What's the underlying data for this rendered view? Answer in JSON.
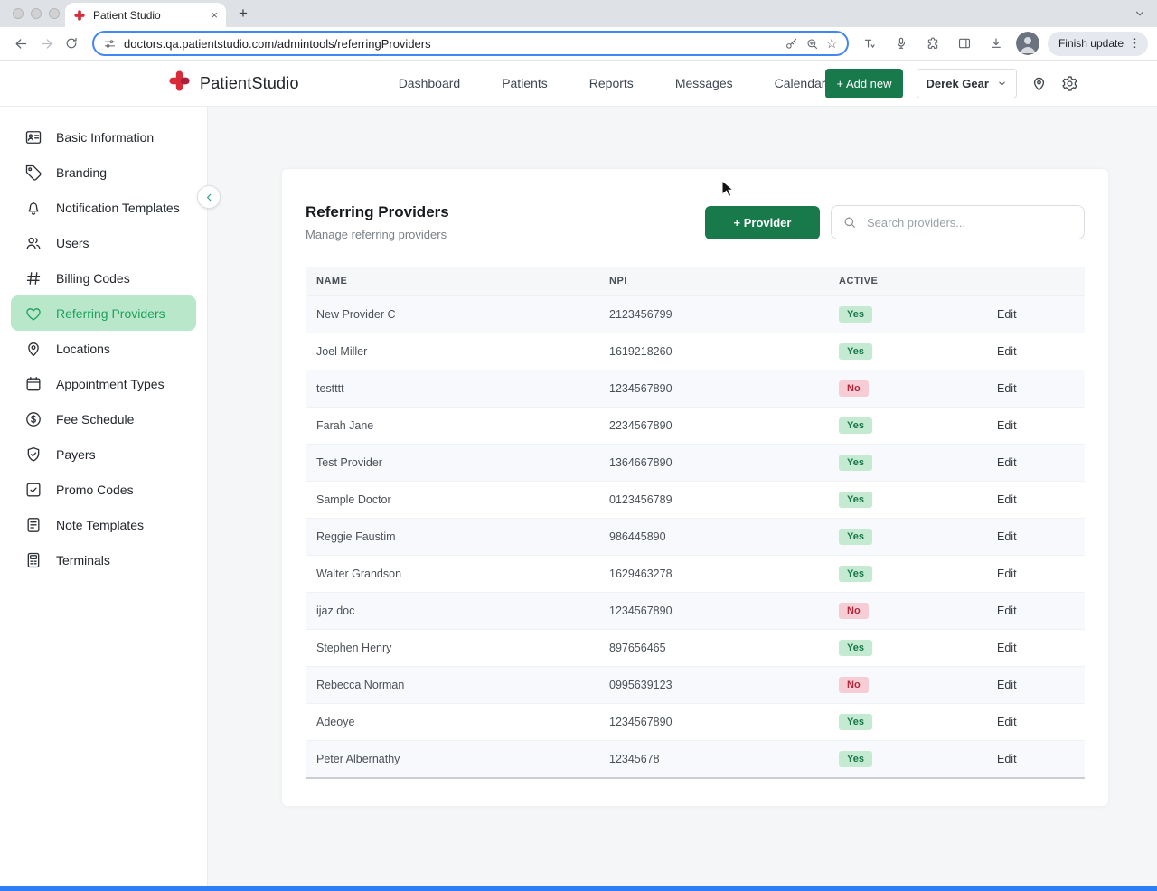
{
  "browser": {
    "tab_title": "Patient Studio",
    "close_tab_glyph": "×",
    "new_tab_glyph": "+",
    "url": "doctors.qa.patientstudio.com/admintools/referringProviders",
    "bookmark_star_glyph": "☆",
    "finish_update_label": "Finish update",
    "menu_dots_glyph": "⋮"
  },
  "app_header": {
    "brand": "PatientStudio",
    "nav": [
      "Dashboard",
      "Patients",
      "Reports",
      "Messages",
      "Calendar"
    ],
    "add_new_label": "+ Add new",
    "user_name": "Derek Gear"
  },
  "sidebar": {
    "items": [
      {
        "label": "Basic Information",
        "icon": "id-card",
        "active": false
      },
      {
        "label": "Branding",
        "icon": "branding",
        "active": false
      },
      {
        "label": "Notification Templates",
        "icon": "bell",
        "active": false
      },
      {
        "label": "Users",
        "icon": "users",
        "active": false
      },
      {
        "label": "Billing Codes",
        "icon": "hash",
        "active": false
      },
      {
        "label": "Referring Providers",
        "icon": "heart",
        "active": true
      },
      {
        "label": "Locations",
        "icon": "map-pin",
        "active": false
      },
      {
        "label": "Appointment Types",
        "icon": "calendar",
        "active": false
      },
      {
        "label": "Fee Schedule",
        "icon": "dollar",
        "active": false
      },
      {
        "label": "Payers",
        "icon": "shield",
        "active": false
      },
      {
        "label": "Promo Codes",
        "icon": "promo",
        "active": false
      },
      {
        "label": "Note Templates",
        "icon": "note",
        "active": false
      },
      {
        "label": "Terminals",
        "icon": "terminal",
        "active": false
      }
    ]
  },
  "main": {
    "title": "Referring Providers",
    "subtitle": "Manage referring providers",
    "add_provider_label": "+ Provider",
    "search_placeholder": "Search providers...",
    "table": {
      "columns": [
        "NAME",
        "NPI",
        "ACTIVE"
      ],
      "rows": [
        {
          "name": "New Provider C",
          "npi": "2123456799",
          "active": "Yes",
          "action": "Edit"
        },
        {
          "name": "Joel Miller",
          "npi": "1619218260",
          "active": "Yes",
          "action": "Edit"
        },
        {
          "name": "testttt",
          "npi": "1234567890",
          "active": "No",
          "action": "Edit"
        },
        {
          "name": "Farah Jane",
          "npi": "2234567890",
          "active": "Yes",
          "action": "Edit"
        },
        {
          "name": "Test Provider",
          "npi": "1364667890",
          "active": "Yes",
          "action": "Edit"
        },
        {
          "name": "Sample Doctor",
          "npi": "0123456789",
          "active": "Yes",
          "action": "Edit"
        },
        {
          "name": "Reggie Faustim",
          "npi": "986445890",
          "active": "Yes",
          "action": "Edit"
        },
        {
          "name": "Walter Grandson",
          "npi": "1629463278",
          "active": "Yes",
          "action": "Edit"
        },
        {
          "name": "ijaz doc",
          "npi": "1234567890",
          "active": "No",
          "action": "Edit"
        },
        {
          "name": "Stephen Henry",
          "npi": "897656465",
          "active": "Yes",
          "action": "Edit"
        },
        {
          "name": "Rebecca Norman",
          "npi": "0995639123",
          "active": "No",
          "action": "Edit"
        },
        {
          "name": "Adeoye",
          "npi": "1234567890",
          "active": "Yes",
          "action": "Edit"
        },
        {
          "name": "Peter Albernathy",
          "npi": "12345678",
          "active": "Yes",
          "action": "Edit"
        }
      ]
    }
  },
  "colors": {
    "accent_green": "#18794b",
    "active_item_bg": "#b9e7ca",
    "active_item_text": "#1fa15e",
    "badge_yes_bg": "#c5ead2",
    "badge_yes_text": "#177648",
    "badge_no_bg": "#f6cdd4",
    "badge_no_text": "#b02a3f",
    "url_focus_ring": "#4285f4",
    "bottom_bar": "#2e7df6",
    "brand_red": "#d92b3a"
  }
}
